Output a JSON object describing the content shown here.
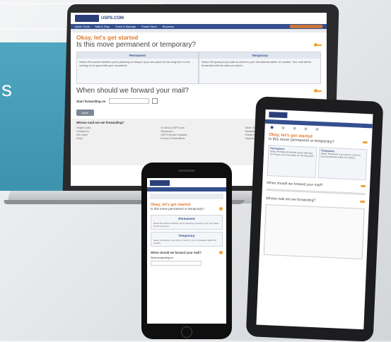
{
  "background": {
    "band_color": "#4fa6c0",
    "band_letter": "s"
  },
  "laptop": {
    "logo_text": "USPS.COM",
    "nav_items": [
      "Quick Tools",
      "Mail & Ship",
      "Track & Manage",
      "Postal Store",
      "Business"
    ],
    "heading_orange": "Okay, let's get started",
    "heading_main": "Is this move permanent or temporary?",
    "options": [
      {
        "title": "Permanent",
        "text": "Select Permanent whether you're planning on living in your new place for the long term or are moving on for good with your household."
      },
      {
        "title": "Temporary",
        "text": "Select Temporary if you plan to return to your old address within 12 months. Your mail will be forwarded until the date you return."
      }
    ],
    "forward_heading": "When should we forward your mail?",
    "start_label": "Start forwarding on",
    "back_label": "Back",
    "next_label": "Next",
    "footer_title": "Whose mail are we forwarding?",
    "footer_cols": [
      [
        "Helpful Links",
        "Contact Us",
        "Site Index",
        "FAQs"
      ],
      [
        "On About.USPS.com",
        "Newsroom",
        "USPS Service Updates",
        "Forms & Publications"
      ],
      [
        "Other USPS Sites",
        "Business Customer Gateway",
        "Postal Inspectors",
        "Inspector General"
      ]
    ]
  },
  "tablet": {
    "heading_orange": "Okay, let's get started",
    "heading_main": "Is this move permanent or temporary?",
    "options": [
      {
        "title": "Permanent",
        "text": "Select Permanent whether you're planning on living in your new place for the long term."
      },
      {
        "title": "Temporary",
        "text": "Select Temporary if you plan to return to your old address within 12 months."
      }
    ],
    "forward_heading": "When should we forward your mail?",
    "whose_heading": "Whose mail are we forwarding?"
  },
  "phone": {
    "heading_orange": "Okay, let's get started",
    "heading_main": "Is this move permanent or temporary?",
    "options": [
      {
        "title": "Permanent",
        "text": "Select Permanent whether you're planning on living in your new place for the long term."
      },
      {
        "title": "Temporary",
        "text": "Select Temporary if you plan to return to your old address within 12 months."
      }
    ],
    "forward_heading": "When should we forward your mail?",
    "start_label": "Start forwarding on"
  }
}
